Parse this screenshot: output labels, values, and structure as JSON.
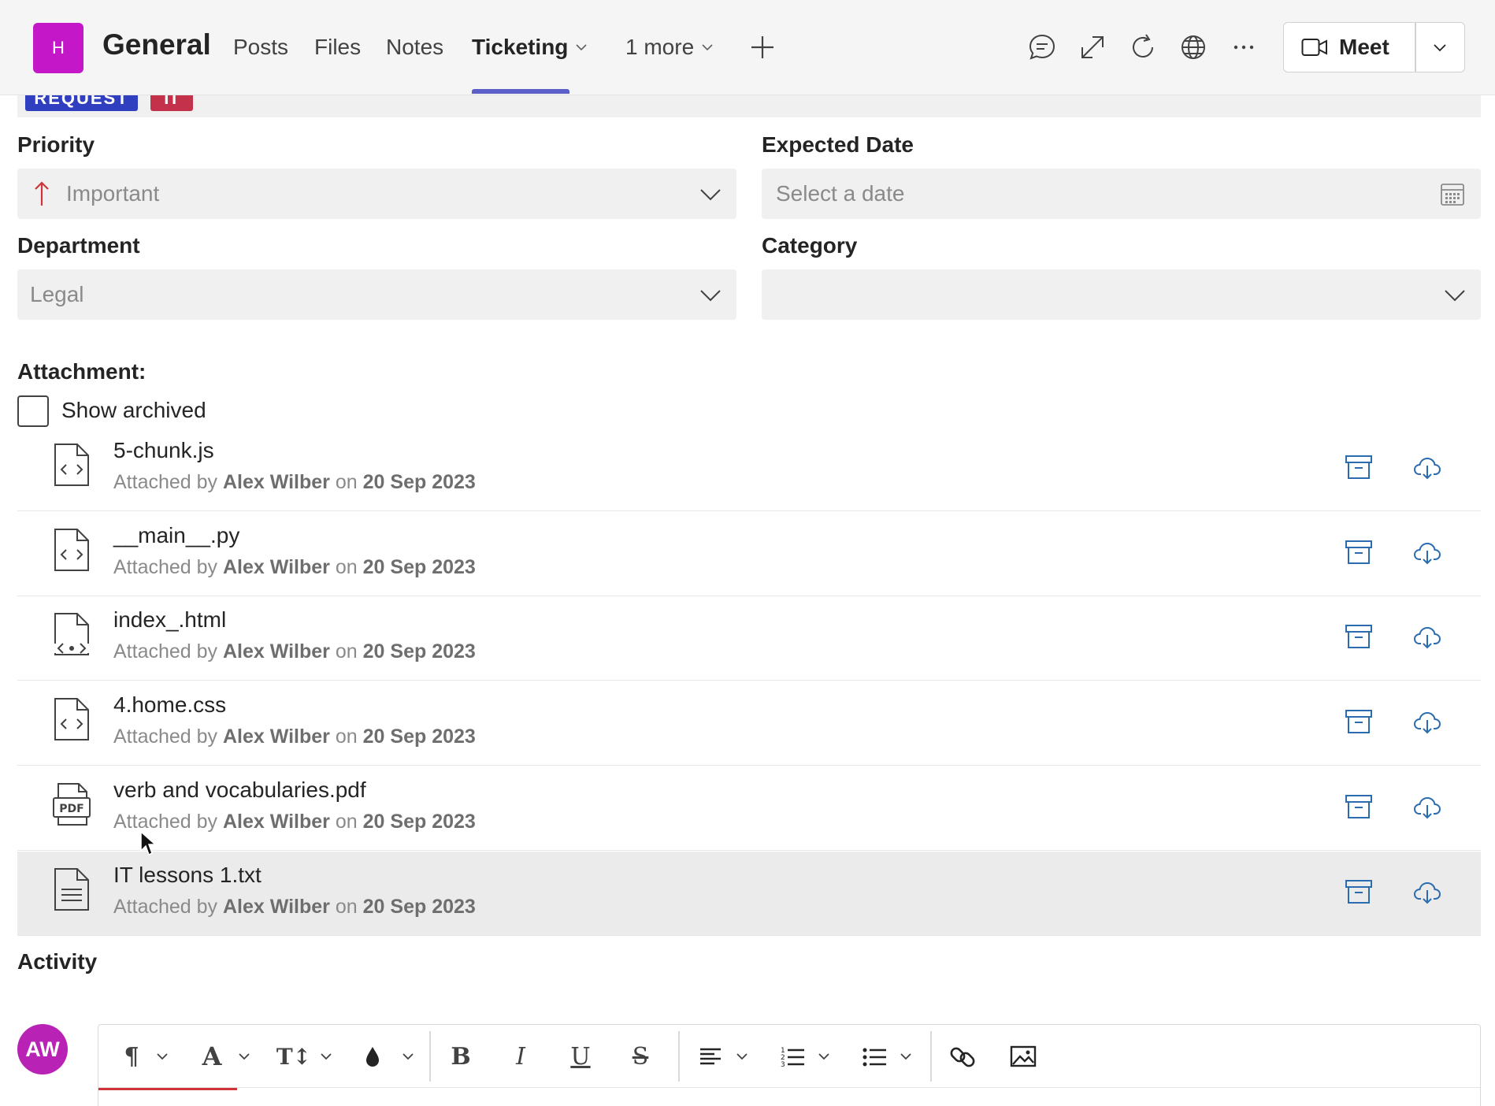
{
  "header": {
    "team_initial": "H",
    "channel_title": "General",
    "tabs": [
      {
        "label": "Posts"
      },
      {
        "label": "Files"
      },
      {
        "label": "Notes"
      },
      {
        "label": "Ticketing"
      },
      {
        "label": "1 more"
      }
    ],
    "meet_label": "Meet"
  },
  "tags": {
    "type": "REQUEST",
    "group": "IT"
  },
  "form": {
    "priority_label": "Priority",
    "priority_value": "Important",
    "expected_date_label": "Expected Date",
    "expected_date_placeholder": "Select a date",
    "department_label": "Department",
    "department_value": "Legal",
    "category_label": "Category",
    "category_value": ""
  },
  "attachments": {
    "label": "Attachment:",
    "show_archived_label": "Show archived",
    "attached_by_text": "Attached by",
    "on_text": "on",
    "items": [
      {
        "name": "5-chunk.js",
        "author": "Alex Wilber",
        "date": "20 Sep 2023",
        "icon": "code-file-icon"
      },
      {
        "name": "__main__.py",
        "author": "Alex Wilber",
        "date": "20 Sep 2023",
        "icon": "code-file-icon"
      },
      {
        "name": "index_.html",
        "author": "Alex Wilber",
        "date": "20 Sep 2023",
        "icon": "html-file-icon"
      },
      {
        "name": "4.home.css",
        "author": "Alex Wilber",
        "date": "20 Sep 2023",
        "icon": "code-file-icon"
      },
      {
        "name": "verb and vocabularies.pdf",
        "author": "Alex Wilber",
        "date": "20 Sep 2023",
        "icon": "pdf-file-icon"
      },
      {
        "name": "IT lessons 1.txt",
        "author": "Alex Wilber",
        "date": "20 Sep 2023",
        "icon": "text-file-icon"
      }
    ]
  },
  "activity": {
    "label": "Activity",
    "user_initials": "AW"
  },
  "colors": {
    "accent": "#5b5fc7",
    "team_avatar": "#c417c8",
    "user_avatar": "#b923b5",
    "action_icon": "#2b6cb0",
    "priority_arrow": "#d13438"
  }
}
